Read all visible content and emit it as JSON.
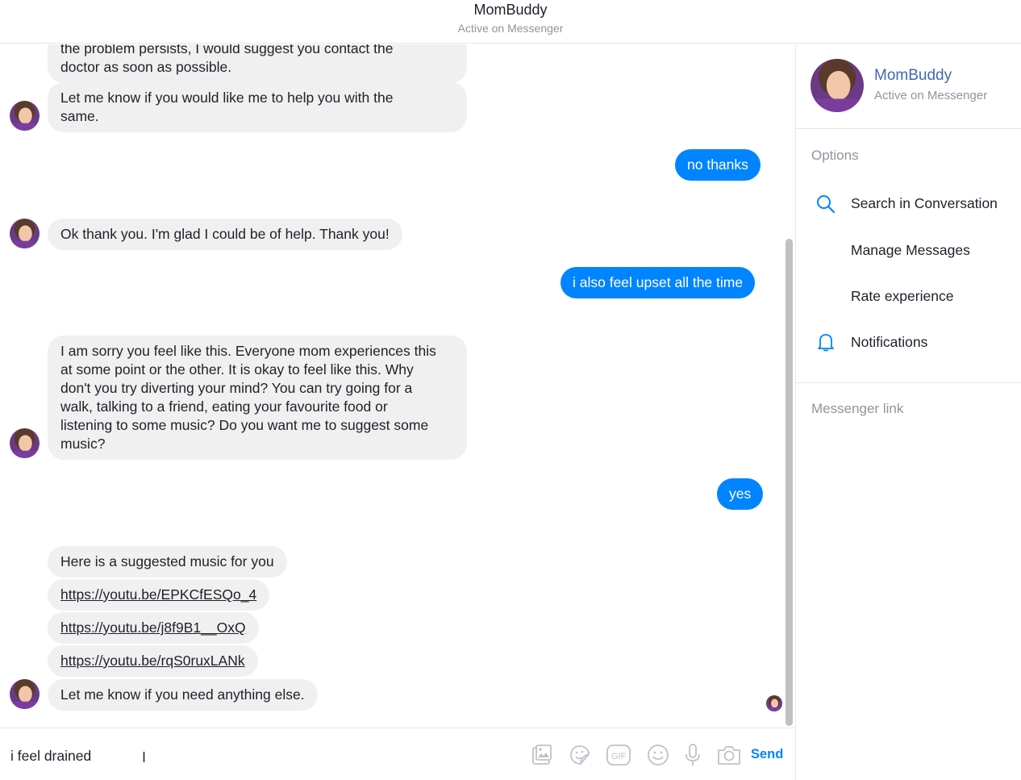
{
  "header": {
    "title": "MomBuddy",
    "subtitle": "Active on Messenger"
  },
  "messages": {
    "m1": "the problem persists, I would suggest you contact the\ndoctor as soon as possible.",
    "m2": "Let me know if you would like me to help you with the\nsame.",
    "m3": "no thanks",
    "m4": "Ok thank you. I'm glad I could be of help. Thank you!",
    "m5": "i also feel upset all the time",
    "m6": "I am sorry you feel like this. Everyone mom experiences this\nat some point or the other. It is okay to feel like this. Why\ndon't you try diverting your mind? You can try going for a\nwalk, talking to a friend, eating your favourite food or\nlistening to some music? Do you want me to suggest some\nmusic?",
    "m7": "yes",
    "m8": "Here is a suggested music for you",
    "m9": "https://youtu.be/EPKCfESQo_4",
    "m10": "https://youtu.be/j8f9B1__OxQ",
    "m11": "https://youtu.be/rqS0ruxLANk",
    "m12": "Let me know if you need anything else."
  },
  "sidebar": {
    "name": "MomBuddy",
    "status": "Active on Messenger",
    "options_title": "Options",
    "options": [
      {
        "label": "Search in Conversation",
        "icon": "search-icon"
      },
      {
        "label": "Manage Messages",
        "icon": ""
      },
      {
        "label": "Rate experience",
        "icon": ""
      },
      {
        "label": "Notifications",
        "icon": "bell-icon"
      }
    ],
    "messenger_link_title": "Messenger link"
  },
  "composer": {
    "text": "i feel drained",
    "send_label": "Send",
    "icons": [
      "photo-icon",
      "sticker-icon",
      "gif-icon",
      "emoji-icon",
      "microphone-icon",
      "camera-icon"
    ]
  },
  "colors": {
    "accent": "#0084ff",
    "bubble_gray": "#f1f0f0",
    "link_blue": "#4267b2",
    "muted": "#90949c"
  }
}
